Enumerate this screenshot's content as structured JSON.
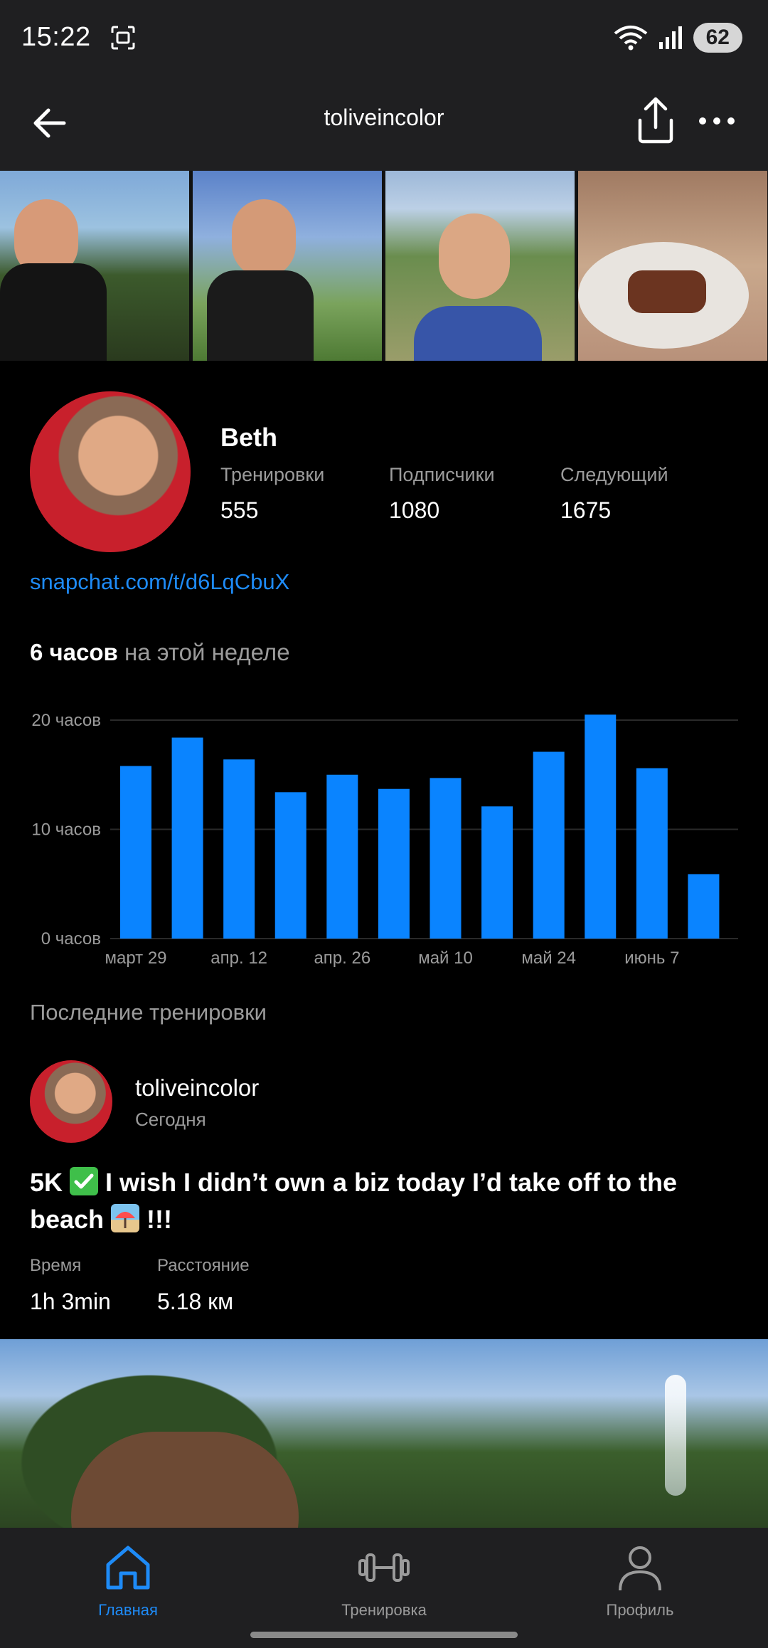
{
  "status": {
    "time": "15:22",
    "battery": "62"
  },
  "appbar": {
    "title": "toliveincolor"
  },
  "profile": {
    "name": "Beth",
    "stats": [
      {
        "label": "Тренировки",
        "value": "555"
      },
      {
        "label": "Подписчики",
        "value": "1080"
      },
      {
        "label": "Следующий",
        "value": "1675"
      }
    ],
    "link": "snapchat.com/t/d6LqCbuX"
  },
  "week": {
    "bold": "6 часов",
    "rest": " на этой неделе"
  },
  "chart_data": {
    "type": "bar",
    "y_ticks": [
      "20 часов",
      "10 часов",
      "0 часов"
    ],
    "x_ticks": [
      "март 29",
      "апр. 12",
      "апр. 26",
      "май 10",
      "май 24",
      "июнь 7"
    ],
    "values": [
      15.8,
      18.4,
      16.4,
      13.4,
      15.0,
      13.7,
      14.7,
      12.1,
      17.1,
      20.5,
      15.6,
      5.9
    ],
    "ylim": [
      0,
      20
    ],
    "bar_color": "#0a84ff",
    "grid": true
  },
  "recent": {
    "title": "Последние тренировки",
    "user": "toliveincolor",
    "date": "Сегодня",
    "text_before_check": "5K ",
    "text_after_check": " I wish I didn’t own a biz today I’d take off to the beach ",
    "text_end": " !!!",
    "metrics": [
      {
        "label": "Время",
        "value": "1h 3min"
      },
      {
        "label": "Расстояние",
        "value": "5.18 км"
      }
    ]
  },
  "nav": [
    {
      "label": "Главная",
      "icon": "home-icon",
      "active": true
    },
    {
      "label": "Тренировка",
      "icon": "dumbbell-icon",
      "active": false
    },
    {
      "label": "Профиль",
      "icon": "person-icon",
      "active": false
    }
  ],
  "colors": {
    "accent": "#1e8bf7",
    "bar": "#0a84ff",
    "bg": "#000000",
    "bar_bg": "#1f1f21"
  }
}
